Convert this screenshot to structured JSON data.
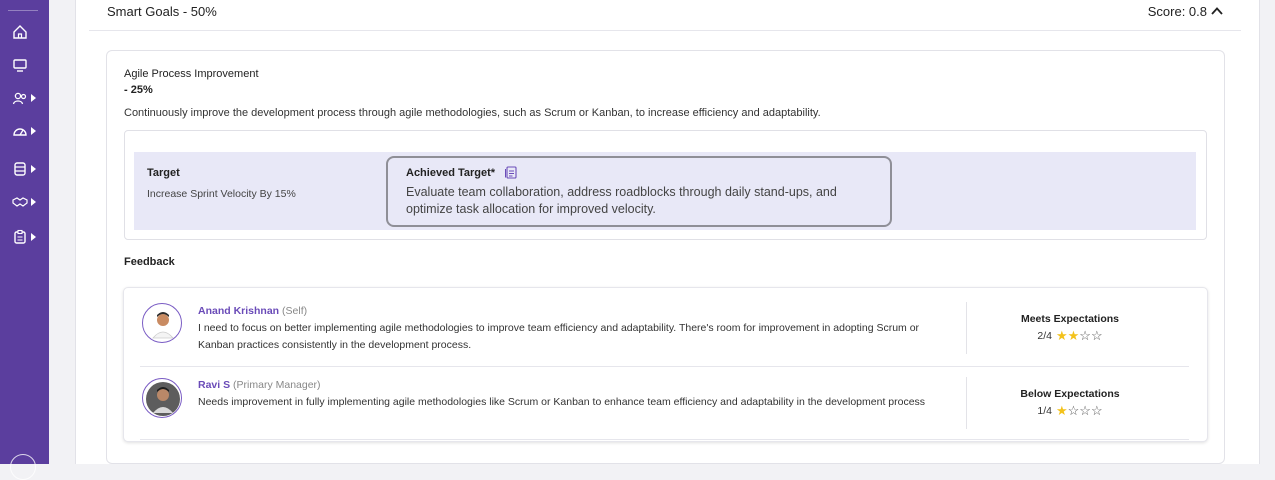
{
  "section": {
    "title": "Smart Goals - 50%",
    "score": "Score: 0.8"
  },
  "goal": {
    "name": "Agile Process Improvement",
    "weight": "- 25%",
    "description": "Continuously improve the development process through agile methodologies, such as Scrum or Kanban, to increase efficiency and adaptability.",
    "target_label": "Target",
    "target_value": "Increase Sprint Velocity By 15%",
    "achieved_label": "Achieved Target*",
    "achieved_text": "Evaluate team collaboration, address roadblocks through daily stand-ups, and optimize task allocation for improved velocity."
  },
  "feedback": {
    "title": "Feedback",
    "entries": [
      {
        "name": "Anand Krishnan",
        "role": "(Self)",
        "comment": "I need to focus on better implementing agile methodologies to improve team efficiency and adaptability. There's room for improvement in adopting Scrum or Kanban practices consistently in the development process.",
        "rating_label": "Meets Expectations",
        "rating_text": "2/4",
        "rating_value": 2,
        "rating_max": 4
      },
      {
        "name": "Ravi S",
        "role": "(Primary Manager)",
        "comment": "Needs improvement in fully implementing agile methodologies like Scrum or Kanban to enhance team efficiency and adaptability in the development process",
        "rating_label": "Below Expectations",
        "rating_text": "1/4",
        "rating_value": 1,
        "rating_max": 4
      }
    ]
  },
  "sidebar": {
    "icons": [
      "home-icon",
      "monitor-icon",
      "people-icon",
      "gauge-icon",
      "database-icon",
      "handshake-icon",
      "clipboard-icon"
    ]
  },
  "colors": {
    "sidebar": "#5b3e9e",
    "accent": "#6a4bb8",
    "star": "#f3c21b",
    "target_band": "#e8e8f7"
  }
}
